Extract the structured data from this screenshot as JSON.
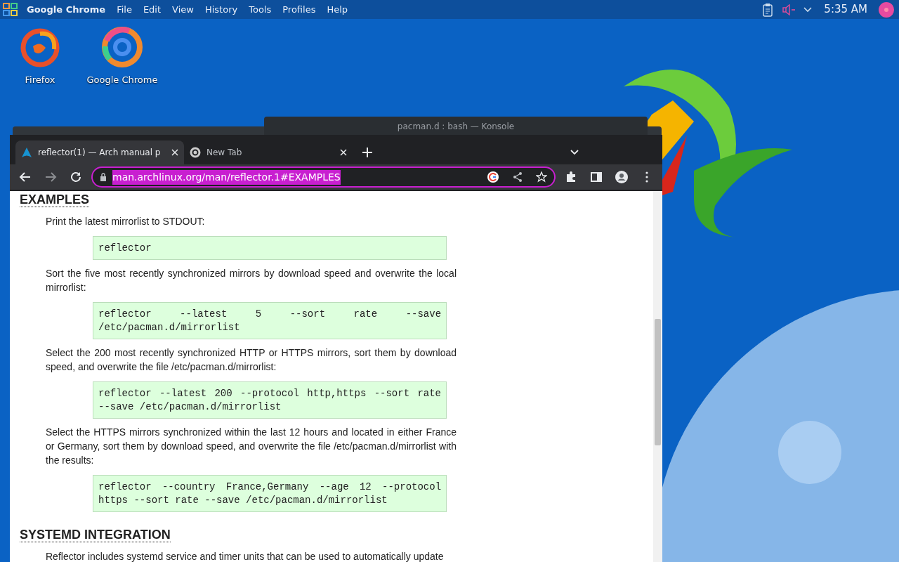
{
  "top_panel": {
    "app_name": "Google Chrome",
    "menu": [
      "File",
      "Edit",
      "View",
      "History",
      "Tools",
      "Profiles",
      "Help"
    ],
    "clock": "5:35 AM"
  },
  "desktop_icons": [
    {
      "kind": "firefox",
      "label": "Firefox"
    },
    {
      "kind": "chrome",
      "label": "Google Chrome"
    }
  ],
  "background_window": {
    "title": "pacman.d : bash — Konsole"
  },
  "browser": {
    "tabs": [
      {
        "title": "reflector(1) — Arch manual p",
        "selected": true
      },
      {
        "title": "New Tab",
        "selected": false
      }
    ],
    "address": "man.archlinux.org/man/reflector.1#EXAMPLES",
    "sections": [
      {
        "heading": "EXAMPLES",
        "blocks": [
          {
            "kind": "text",
            "text": "Print the latest mirrorlist to STDOUT:"
          },
          {
            "kind": "code",
            "text": "reflector"
          },
          {
            "kind": "text",
            "text": "Sort the five most recently synchronized mirrors by download speed and overwrite the local mirrorlist:"
          },
          {
            "kind": "code",
            "text": "reflector --latest 5 --sort rate --save /etc/pacman.d/mirrorlist"
          },
          {
            "kind": "text",
            "text": "Select the 200 most recently synchronized HTTP or HTTPS mirrors, sort them by download speed, and overwrite the file /etc/pacman.d/mirrorlist:"
          },
          {
            "kind": "code",
            "text": "reflector --latest 200 --protocol http,https --sort rate --save /etc/pacman.d/mirrorlist"
          },
          {
            "kind": "text",
            "text": "Select the HTTPS mirrors synchronized within the last 12 hours and located in either France or Germany, sort them by download speed, and overwrite the file /etc/pacman.d/mirrorlist with the results:"
          },
          {
            "kind": "code",
            "text": "reflector --country France,Germany --age 12 --protocol https --sort rate --save /etc/pacman.d/mirrorlist"
          }
        ]
      },
      {
        "heading": "SYSTEMD INTEGRATION",
        "blocks": [
          {
            "kind": "text",
            "text": "Reflector includes systemd service and timer units that can be used to automatically update"
          }
        ]
      }
    ]
  }
}
